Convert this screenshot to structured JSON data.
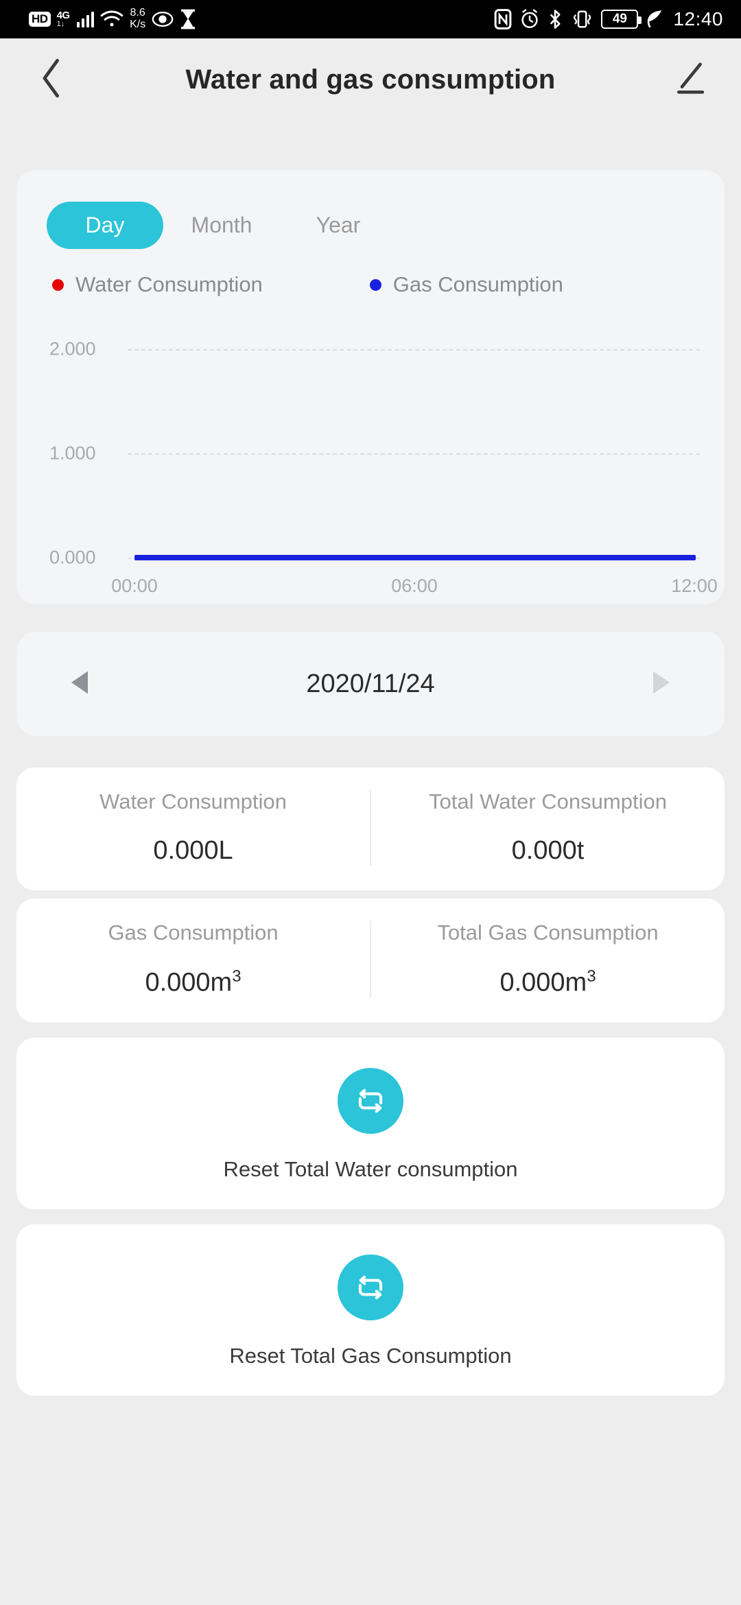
{
  "status_bar": {
    "hd_badge": "HD",
    "network_type": "4G",
    "data_rate_value": "8.6",
    "data_rate_unit": "K/s",
    "battery_percent": "49",
    "time": "12:40",
    "icons": [
      "hd-icon",
      "signal-icon",
      "wifi-icon",
      "eye-icon",
      "hourglass-icon",
      "nfc-icon",
      "alarm-icon",
      "bluetooth-icon",
      "vibrate-icon",
      "battery-icon",
      "leaf-icon"
    ]
  },
  "header": {
    "title": "Water and gas consumption",
    "back_icon": "back-chevron-icon",
    "edit_icon": "pencil-edit-icon"
  },
  "chart_panel": {
    "tabs": [
      {
        "label": "Day",
        "active": true
      },
      {
        "label": "Month",
        "active": false
      },
      {
        "label": "Year",
        "active": false
      }
    ],
    "legend": [
      {
        "label": "Water Consumption",
        "color": "#e60000"
      },
      {
        "label": "Gas Consumption",
        "color": "#1a22e0"
      }
    ]
  },
  "chart_data": {
    "type": "line",
    "title": "",
    "xlabel": "",
    "ylabel": "",
    "ylim": [
      0,
      2
    ],
    "yticks": [
      "0.000",
      "1.000",
      "2.000"
    ],
    "xticks": [
      "00:00",
      "06:00",
      "12:00"
    ],
    "xlim": [
      0,
      12
    ],
    "grid": true,
    "legend_position": "top",
    "series": [
      {
        "name": "Water Consumption",
        "color": "#e60000",
        "x": [],
        "values": []
      },
      {
        "name": "Gas Consumption",
        "color": "#1a22e0",
        "x": [
          0,
          12
        ],
        "values": [
          0.0,
          0.0
        ]
      }
    ]
  },
  "date_nav": {
    "prev_icon": "triangle-left-icon",
    "next_icon": "triangle-right-icon",
    "date": "2020/11/24"
  },
  "stats": [
    {
      "left_label": "Water Consumption",
      "left_value": "0.000L",
      "right_label": "Total Water Consumption",
      "right_value": "0.000t"
    },
    {
      "left_label": "Gas Consumption",
      "left_value": "0.000m",
      "left_sup": "3",
      "right_label": "Total Gas Consumption",
      "right_value": "0.000m",
      "right_sup": "3"
    }
  ],
  "reset_actions": [
    {
      "label": "Reset Total Water consumption",
      "icon": "reset-loop-icon"
    },
    {
      "label": "Reset Total Gas Consumption",
      "icon": "reset-loop-icon"
    }
  ],
  "colors": {
    "accent": "#2bc4d8",
    "water": "#e60000",
    "gas": "#1a22e0",
    "page_bg": "#ededed",
    "card_bg": "#f4f5f7"
  }
}
